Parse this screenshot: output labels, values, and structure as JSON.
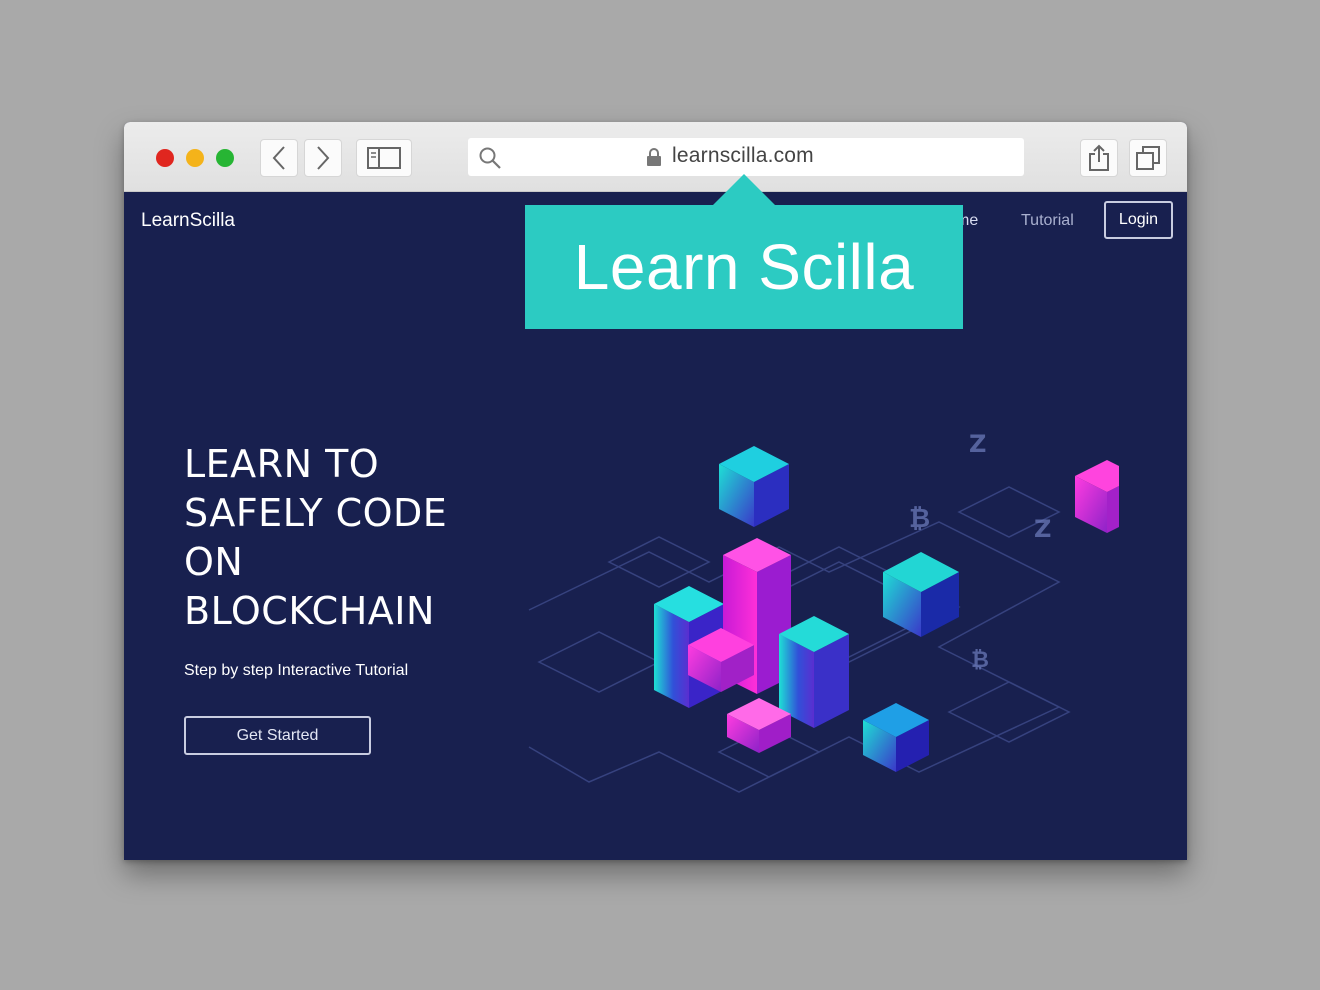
{
  "browser": {
    "url": "learnscilla.com"
  },
  "site": {
    "logo": "LearnScilla",
    "nav": {
      "home_partial": "me",
      "tutorial": "Tutorial",
      "login": "Login"
    },
    "hero": {
      "title_lines": [
        "LEARN TO",
        "SAFELY CODE",
        "ON",
        "BLOCKCHAIN"
      ],
      "subtitle": "Step by step Interactive Tutorial",
      "cta": "Get Started"
    }
  },
  "callout": {
    "text": "Learn Scilla",
    "color": "#2ccbc2"
  },
  "icons": [
    "back-icon",
    "forward-icon",
    "sidebar-icon",
    "search-icon",
    "lock-icon",
    "share-icon",
    "tabs-icon"
  ],
  "colors": {
    "page_bg": "#18204f",
    "accent_cyan": "#1ee0d5",
    "accent_magenta": "#f020d0"
  }
}
